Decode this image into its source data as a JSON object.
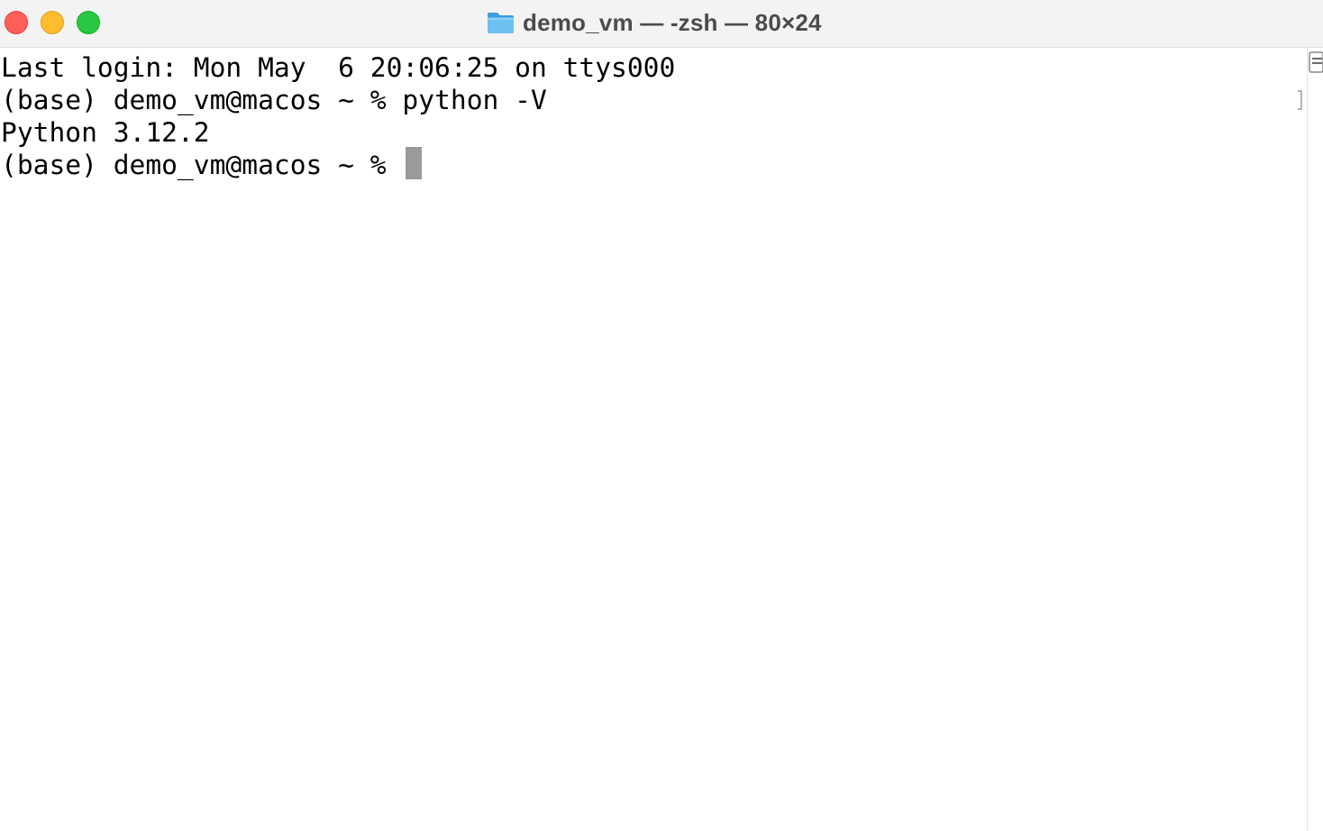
{
  "window": {
    "title": "demo_vm — -zsh — 80×24",
    "title_icon": "folder-icon",
    "controls": {
      "close": "close-button",
      "minimize": "minimize-button",
      "zoom": "zoom-button"
    }
  },
  "terminal": {
    "lines": [
      "Last login: Mon May  6 20:06:25 on ttys000",
      "(base) demo_vm@macos ~ % python -V",
      "Python 3.12.2",
      "(base) demo_vm@macos ~ % "
    ],
    "cursor": "block-cursor"
  },
  "colors": {
    "titlebar": "#f3f3f3",
    "close": "#ff5f57",
    "minimize": "#febc2e",
    "zoom": "#28c840",
    "cursor": "#9a9a9a",
    "text": "#000000",
    "title_text": "#4b4b4b",
    "folder": "#5ab4ef"
  }
}
